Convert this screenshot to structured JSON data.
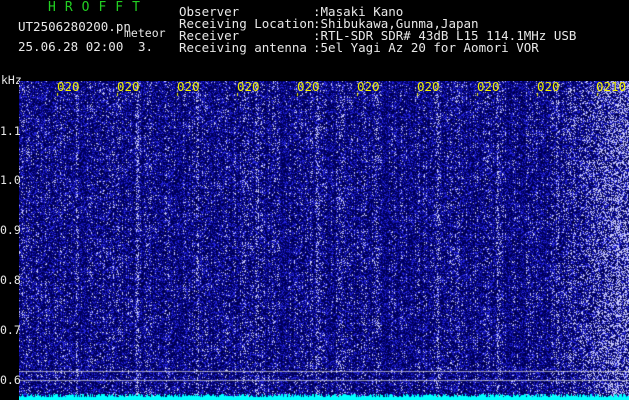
{
  "app": {
    "title": "HROFFT",
    "file_name": "UT2506280200.pn",
    "meteor_label": "meteor",
    "date_time": "25.06.28 02:00",
    "count": "3."
  },
  "metadata": [
    {
      "key": "Observer",
      "value": ":Masaki Kano"
    },
    {
      "key": "Receiving Location",
      "value": ":Shibukawa,Gunma,Japan"
    },
    {
      "key": "Receiver",
      "value": ":RTL-SDR SDR# 43dB L15 114.1MHz USB"
    },
    {
      "key": "Receiving antenna",
      "value": ":5el Yagi Az 20 for Aomori VOR"
    }
  ],
  "plot": {
    "unit_label": "kHz",
    "y_ticks": [
      {
        "label": "1.1",
        "value": 1.1
      },
      {
        "label": "1.0",
        "value": 1.0
      },
      {
        "label": "0.9",
        "value": 0.9
      },
      {
        "label": "0.8",
        "value": 0.8
      },
      {
        "label": "0.7",
        "value": 0.7
      },
      {
        "label": "0.6",
        "value": 0.6
      }
    ],
    "x_ticks": [
      "020",
      "020",
      "020",
      "020",
      "020",
      "020",
      "020",
      "020",
      "020",
      "0210"
    ],
    "colors": {
      "background": "#000066",
      "signal": "#3a3aff",
      "bright": "#ffffff",
      "tick": "#ffff00",
      "baseline": "#00ffff",
      "hline": "#d8d8d8"
    }
  }
}
